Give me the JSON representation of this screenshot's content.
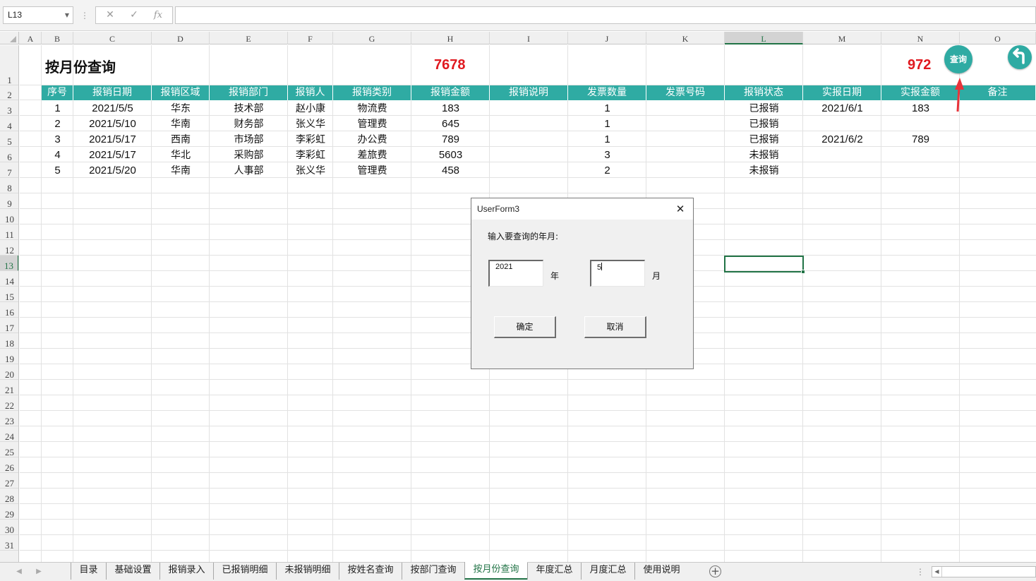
{
  "formula_bar": {
    "name_box": "L13",
    "cancel_icon": "✕",
    "enter_icon": "✓",
    "function_icon": "fx",
    "formula_value": ""
  },
  "columns": [
    "A",
    "B",
    "C",
    "D",
    "E",
    "F",
    "G",
    "H",
    "I",
    "J",
    "K",
    "L",
    "M",
    "N",
    "O"
  ],
  "selected_column": "L",
  "rows": [
    "1",
    "2",
    "3",
    "4",
    "5",
    "6",
    "7",
    "8",
    "9",
    "10",
    "11",
    "12",
    "13",
    "14",
    "15",
    "16",
    "17",
    "18",
    "19",
    "20",
    "21",
    "22",
    "23",
    "24",
    "25",
    "26",
    "27",
    "28",
    "29",
    "30",
    "31"
  ],
  "selected_row": "13",
  "sheet": {
    "title": "按月份查询",
    "total_amount": "7678",
    "reimbursed_amount": "972",
    "query_button": "查询",
    "back_icon": "return-arrow-icon",
    "headers": [
      "序号",
      "报销日期",
      "报销区域",
      "报销部门",
      "报销人",
      "报销类别",
      "报销金额",
      "报销说明",
      "发票数量",
      "发票号码",
      "报销状态",
      "实报日期",
      "实报金额",
      "备注"
    ],
    "records": [
      [
        "1",
        "2021/5/5",
        "华东",
        "技术部",
        "赵小康",
        "物流费",
        "183",
        "",
        "1",
        "",
        "已报销",
        "2021/6/1",
        "183",
        ""
      ],
      [
        "2",
        "2021/5/10",
        "华南",
        "财务部",
        "张义华",
        "管理费",
        "645",
        "",
        "1",
        "",
        "已报销",
        "",
        "",
        ""
      ],
      [
        "3",
        "2021/5/17",
        "西南",
        "市场部",
        "李彩虹",
        "办公费",
        "789",
        "",
        "1",
        "",
        "已报销",
        "2021/6/2",
        "789",
        ""
      ],
      [
        "4",
        "2021/5/17",
        "华北",
        "采购部",
        "李彩虹",
        "差旅费",
        "5603",
        "",
        "3",
        "",
        "未报销",
        "",
        "",
        ""
      ],
      [
        "5",
        "2021/5/20",
        "华南",
        "人事部",
        "张义华",
        "管理费",
        "458",
        "",
        "2",
        "",
        "未报销",
        "",
        "",
        ""
      ]
    ]
  },
  "dialog": {
    "title": "UserForm3",
    "prompt": "输入要查询的年月:",
    "year_value": "2021",
    "year_unit": "年",
    "month_value": "5",
    "month_unit": "月",
    "ok_label": "确定",
    "cancel_label": "取消"
  },
  "tabs": [
    "目录",
    "基础设置",
    "报销录入",
    "已报销明细",
    "未报销明细",
    "按姓名查询",
    "按部门查询",
    "按月份查询",
    "年度汇总",
    "月度汇总",
    "使用说明"
  ],
  "active_tab": "按月份查询",
  "colors": {
    "header_teal": "#2faba3",
    "highlight_red": "#e0191f",
    "excel_green": "#217346"
  }
}
